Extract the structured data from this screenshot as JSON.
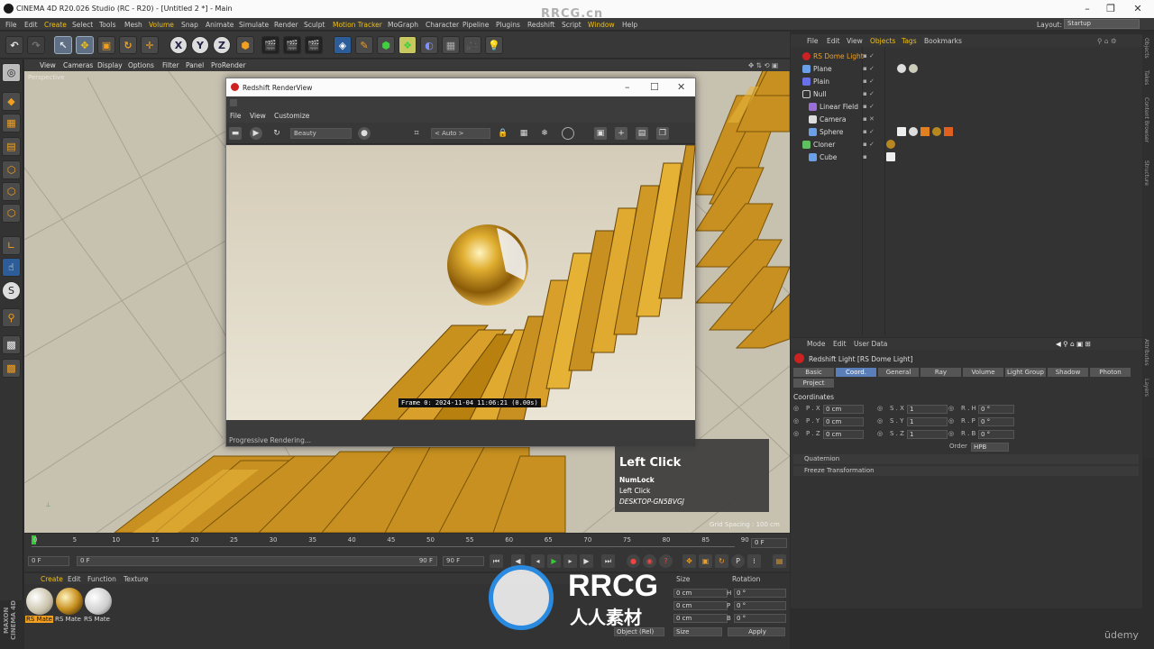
{
  "titlebar": {
    "title": "CINEMA 4D R20.026 Studio (RC - R20) - [Untitled 2 *] - Main",
    "watermark": "RRCG.cn"
  },
  "menubar": {
    "items": [
      "File",
      "Edit",
      "Create",
      "Select",
      "Tools",
      "Mesh",
      "Volume",
      "Snap",
      "Animate",
      "Simulate",
      "Render",
      "Sculpt",
      "Motion Tracker",
      "MoGraph",
      "Character",
      "Pipeline",
      "Plugins",
      "Redshift",
      "Script",
      "Window",
      "Help"
    ],
    "layout_label": "Layout:",
    "layout_value": "Startup"
  },
  "viewport": {
    "menu": [
      "View",
      "Cameras",
      "Display",
      "Options",
      "Filter",
      "Panel",
      "ProRender"
    ],
    "camera": "Perspective",
    "grid_spacing": "Grid Spacing : 100 cm"
  },
  "renderview": {
    "title": "Redshift RenderView",
    "menu": [
      "File",
      "View",
      "Customize"
    ],
    "aov_select": "Beauty",
    "zoom_select": "< Auto >",
    "frame_info": "Frame  0:  2024-11-04  11:06:21  (0.00s)",
    "status": "Progressive Rendering..."
  },
  "objects": {
    "menu": [
      "File",
      "Edit",
      "View",
      "Objects",
      "Tags",
      "Bookmarks"
    ],
    "rows": [
      {
        "name": "RS Dome Light",
        "highlight": true
      },
      {
        "name": "Plane"
      },
      {
        "name": "Plain"
      },
      {
        "name": "Null"
      },
      {
        "name": "Linear Field"
      },
      {
        "name": "Camera"
      },
      {
        "name": "Sphere"
      },
      {
        "name": "Cloner"
      },
      {
        "name": "Cube"
      }
    ]
  },
  "attributes": {
    "menu": [
      "Mode",
      "Edit",
      "User Data"
    ],
    "title": "Redshift Light [RS Dome Light]",
    "tabs": [
      "Basic",
      "Coord.",
      "General",
      "Ray",
      "Volume",
      "Light Group",
      "Shadow",
      "Photon",
      "Project"
    ],
    "active_tab": "Coord.",
    "section": "Coordinates",
    "fields": [
      {
        "label": "P . X",
        "value": "0 cm",
        "slabel": "S . X",
        "svalue": "1",
        "rlabel": "R . H",
        "rvalue": "0 °"
      },
      {
        "label": "P . Y",
        "value": "0 cm",
        "slabel": "S . Y",
        "svalue": "1",
        "rlabel": "R . P",
        "rvalue": "0 °"
      },
      {
        "label": "P . Z",
        "value": "0 cm",
        "slabel": "S . Z",
        "svalue": "1",
        "rlabel": "R . B",
        "rvalue": "0 °"
      }
    ],
    "order_label": "Order",
    "order_value": "HPB",
    "collapsed": [
      "Quaternion",
      "Freeze Transformation"
    ]
  },
  "timeline": {
    "ticks": [
      "0",
      "5",
      "10",
      "15",
      "20",
      "25",
      "30",
      "35",
      "40",
      "45",
      "50",
      "55",
      "60",
      "65",
      "70",
      "75",
      "80",
      "85",
      "90"
    ],
    "current_frame": "0 F"
  },
  "playbar": {
    "start": "0 F",
    "mid": "0 F",
    "end_small": "90 F",
    "end": "90 F"
  },
  "materials": {
    "menu": [
      "Create",
      "Edit",
      "Function",
      "Texture"
    ],
    "items": [
      "RS Mate",
      "RS Mate",
      "RS Mate"
    ]
  },
  "coord_manager": {
    "headers": [
      "Size",
      "Rotation"
    ],
    "rows": [
      {
        "s": "0 cm",
        "rl": "H",
        "r": "0 °"
      },
      {
        "s": "0 cm",
        "rl": "P",
        "r": "0 °"
      },
      {
        "s": "0 cm",
        "rl": "B",
        "r": "0 °"
      }
    ],
    "mode_select": "Object (Rel)",
    "size_select": "Size",
    "apply": "Apply"
  },
  "tooltip": {
    "title": "Left Click",
    "line1": "NumLock",
    "line2": "Left Click",
    "line3": "DESKTOP-GN5BVGJ"
  },
  "branding": {
    "maxon": "MAXON CINEMA 4D",
    "logo_text": "RRCG",
    "logo_sub": "人人素材",
    "udemy": "ūdemy"
  },
  "right_tabs": [
    "Objects",
    "Takes",
    "Content Browser",
    "Structure",
    "Attributes",
    "Layers"
  ],
  "colors": {
    "accent_yellow": "#f0c010",
    "active_tab": "#5a7fb8",
    "gold": "#d8a02a"
  }
}
